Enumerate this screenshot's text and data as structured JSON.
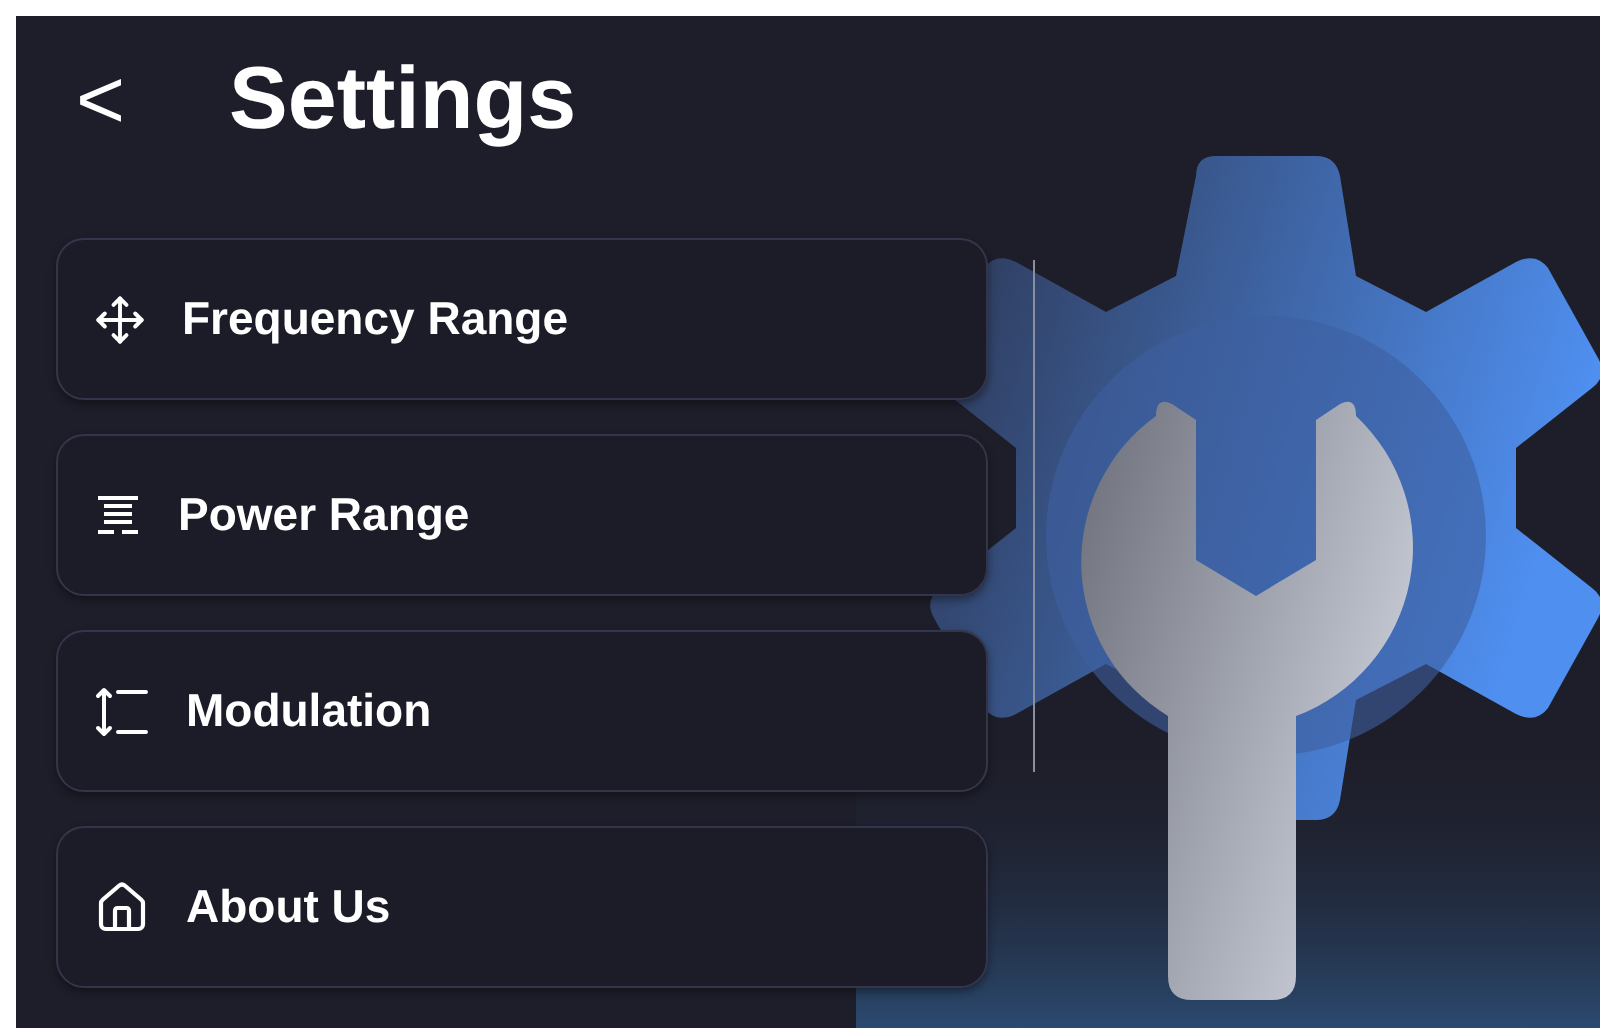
{
  "header": {
    "back": "<",
    "title": "Settings"
  },
  "menu": [
    {
      "label": "Frequency Range"
    },
    {
      "label": "Power Range"
    },
    {
      "label": "Modulation"
    },
    {
      "label": "About Us"
    }
  ]
}
